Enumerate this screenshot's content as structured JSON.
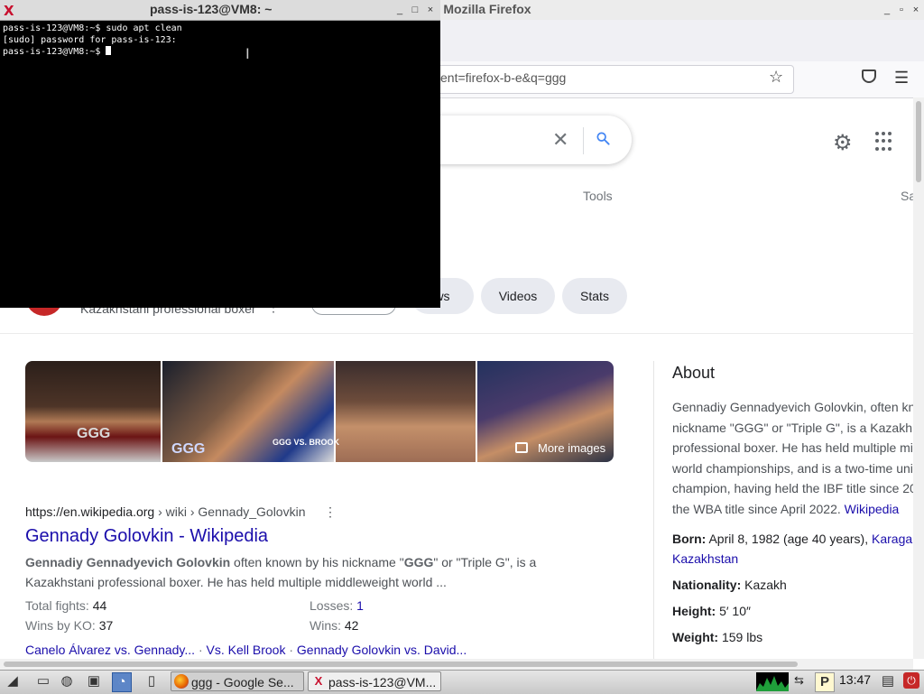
{
  "firefox": {
    "title": "arch — Mozilla Firefox",
    "url": "ent=firefox-b-e&q=ggg",
    "controls": [
      "_",
      "▫",
      "×"
    ]
  },
  "google": {
    "tools_label": "Tools",
    "partial_right_label": "Sa",
    "chips": [
      "ws",
      "Videos",
      "Stats"
    ],
    "entity_subtitle": "Kazakhstani professional boxer",
    "more_images": "More images",
    "image_overlay_texts": [
      "GGG",
      "GGG",
      "GGG VS. BROOK"
    ],
    "result": {
      "cite_domain": "https://en.wikipedia.org",
      "cite_path": " › wiki › Gennady_Golovkin",
      "title": "Gennady Golovkin - Wikipedia",
      "snippet_bold1": "Gennadiy Gennadyevich Golovkin",
      "snippet_part1": " often known by his nickname \"",
      "snippet_bold2": "GGG",
      "snippet_part2": "\" or \"Triple G\", is a Kazakhstani professional boxer. He has held multiple middleweight world ...",
      "facts": [
        {
          "label": "Total fights: ",
          "value": "44"
        },
        {
          "label": "Losses: ",
          "value": "1"
        },
        {
          "label": "Wins by KO: ",
          "value": "37"
        },
        {
          "label": "Wins: ",
          "value": "42"
        }
      ],
      "sitelinks": [
        "Canelo Álvarez vs. Gennady...",
        "Vs. Kell Brook",
        "Gennady Golovkin vs. David..."
      ],
      "sitelink_sep": " · "
    },
    "knowledge_panel": {
      "title": "About",
      "lines": [
        "Gennadiy Gennadyevich Golovkin, often kn",
        "nickname \"GGG\" or \"Triple G\", is a Kazakh",
        "professional boxer. He has held multiple mi",
        "world championships, and is a two-time uni",
        "champion, having held the IBF title since 20",
        "the WBA title since April 2022. "
      ],
      "source_link": "Wikipedia",
      "born_label": "Born:",
      "born_value": " April 8, 1982 (age 40 years), ",
      "born_place1": "Karaga",
      "born_place2": "Kazakhstan",
      "nationality_label": "Nationality:",
      "nationality_value": " Kazakh",
      "height_label": "Height:",
      "height_value": " 5′ 10″",
      "weight_label": "Weight:",
      "weight_value": " 159 lbs"
    }
  },
  "terminal": {
    "logo": "X",
    "title": "pass-is-123@VM8: ~",
    "lines": [
      "pass-is-123@VM8:~$ sudo apt clean",
      "[sudo] password for pass-is-123:",
      "pass-is-123@VM8:~$ "
    ],
    "controls": [
      "_",
      "□",
      "×"
    ]
  },
  "taskbar": {
    "tasks": [
      {
        "label": "ggg - Google Se..."
      },
      {
        "label": "pass-is-123@VM..."
      }
    ],
    "term_task_logo": "X",
    "clock": "13:47"
  }
}
